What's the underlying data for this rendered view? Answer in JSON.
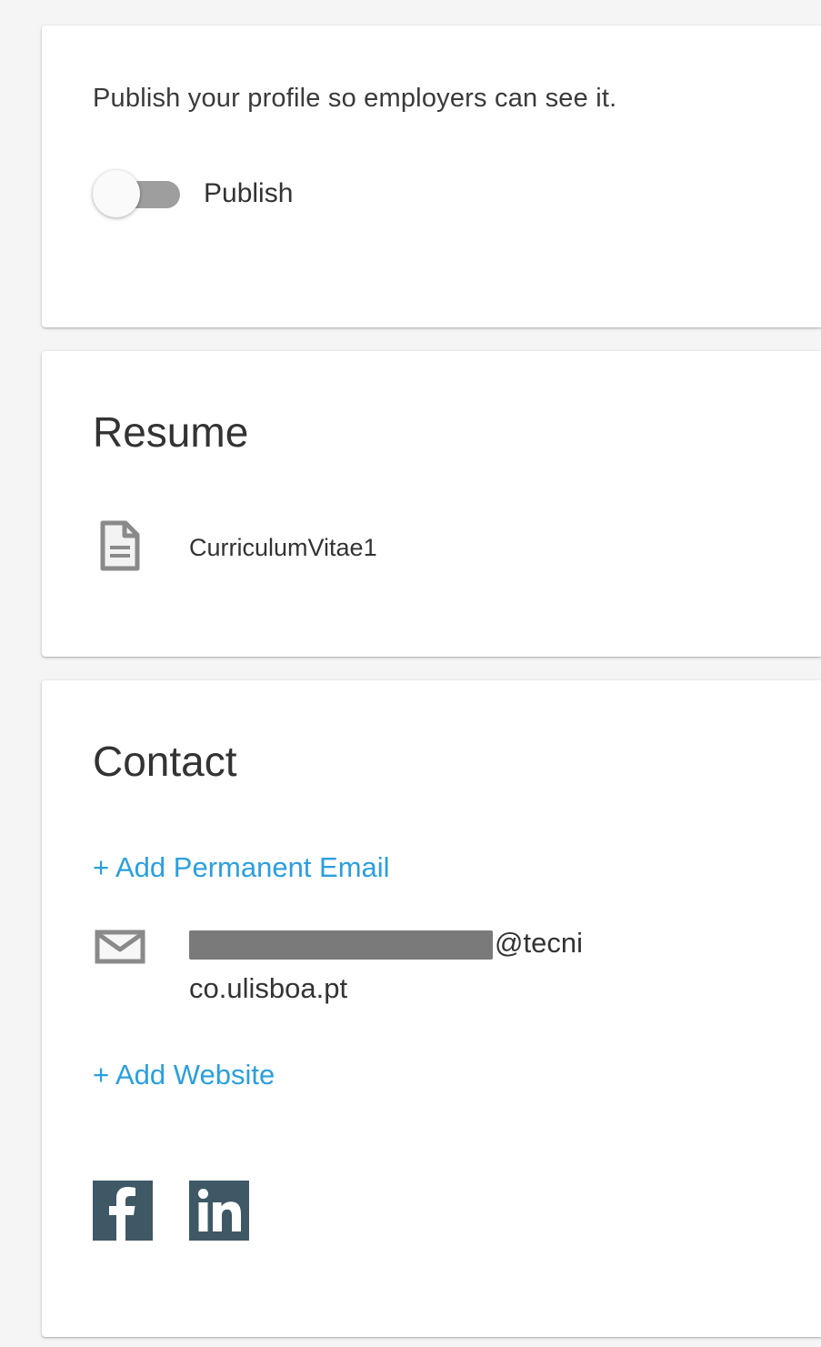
{
  "publish": {
    "description": "Publish your profile so employers can see it.",
    "toggle_label": "Publish",
    "toggle_state": "off"
  },
  "resume": {
    "title": "Resume",
    "file_name": "CurriculumVitae1"
  },
  "contact": {
    "title": "Contact",
    "add_email_label": "+ Add Permanent Email",
    "email_domain": "@tecni",
    "email_domain_cont": "co.ulisboa.pt",
    "add_website_label": "+ Add Website"
  },
  "social": {
    "facebook_icon": "facebook-icon",
    "linkedin_icon": "linkedin-icon"
  },
  "colors": {
    "link": "#2b9fde",
    "social_bg": "#3f5866",
    "toggle_track": "#9e9e9e"
  }
}
